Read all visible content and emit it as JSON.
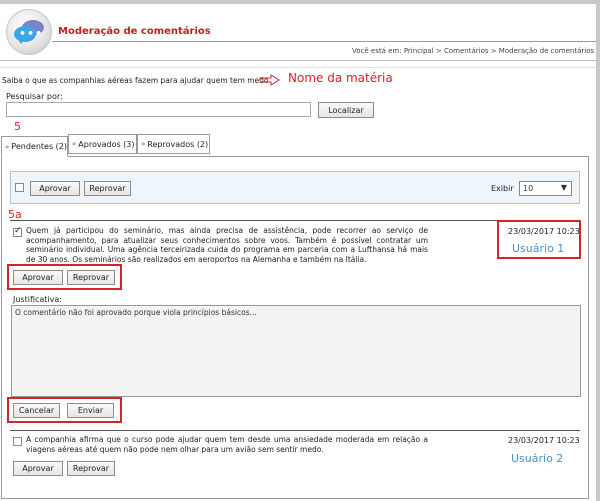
{
  "header": {
    "title": "Moderação de comentários",
    "breadcrumb": "Você está em: Principal > Comentários > Moderação de comentários",
    "logo_icon": "speech-bubbles-icon"
  },
  "article": {
    "title": "Saiba o que as companhias aéreas fazem para ajudar quem tem medo"
  },
  "search": {
    "label": "Pesquisar por:",
    "value": "",
    "placeholder": "",
    "button": "Localizar"
  },
  "tabs": [
    {
      "label": "Pendentes (2)",
      "active": true
    },
    {
      "label": "Aprovados (3)",
      "active": false
    },
    {
      "label": "Reprovados (2)",
      "active": false
    }
  ],
  "toolbar": {
    "approve": "Aprovar",
    "reject": "Reprovar",
    "show_label": "Exibir",
    "show_value": "10"
  },
  "comments": [
    {
      "checked": true,
      "text": "Quem já participou do seminário, mas ainda precisa de assistência, pode recorrer ao serviço de acompanhamento, para atualizar seus conhecimentos sobre voos. Também é possível contratar um seminário individual. Uma agência terceirizada cuida do programa em parceria com a Lufthansa há mais de 30 anos. Os seminários são realizados em aeroportos na Alemanha e também na Itália.",
      "date": "23/03/2017 10:23",
      "approve": "Aprovar",
      "reject": "Reprovar",
      "justification_label": "Justificativa:",
      "justification_value": "O comentário não foi aprovado porque viola princípios básicos...",
      "cancel": "Cancelar",
      "send": "Enviar"
    },
    {
      "checked": false,
      "text": "A companhia afirma que o curso pode ajudar quem tem desde uma ansiedade moderada em relação a viagens aéreas até quem não pode nem olhar para um avião sem sentir medo.",
      "date": "23/03/2017 10:23",
      "approve": "Aprovar",
      "reject": "Reprovar"
    }
  ],
  "annotations": {
    "article_name": "Nome da matéria",
    "tabs_marker": "5",
    "comment_marker": "5a",
    "user1": "Usuário 1",
    "user2": "Usuário 2"
  },
  "colors": {
    "title_red": "#c0211f",
    "annotation_red": "#d8222a",
    "annotation_blue": "#4a90c8",
    "toolbar_bg": "#eef5fb"
  }
}
